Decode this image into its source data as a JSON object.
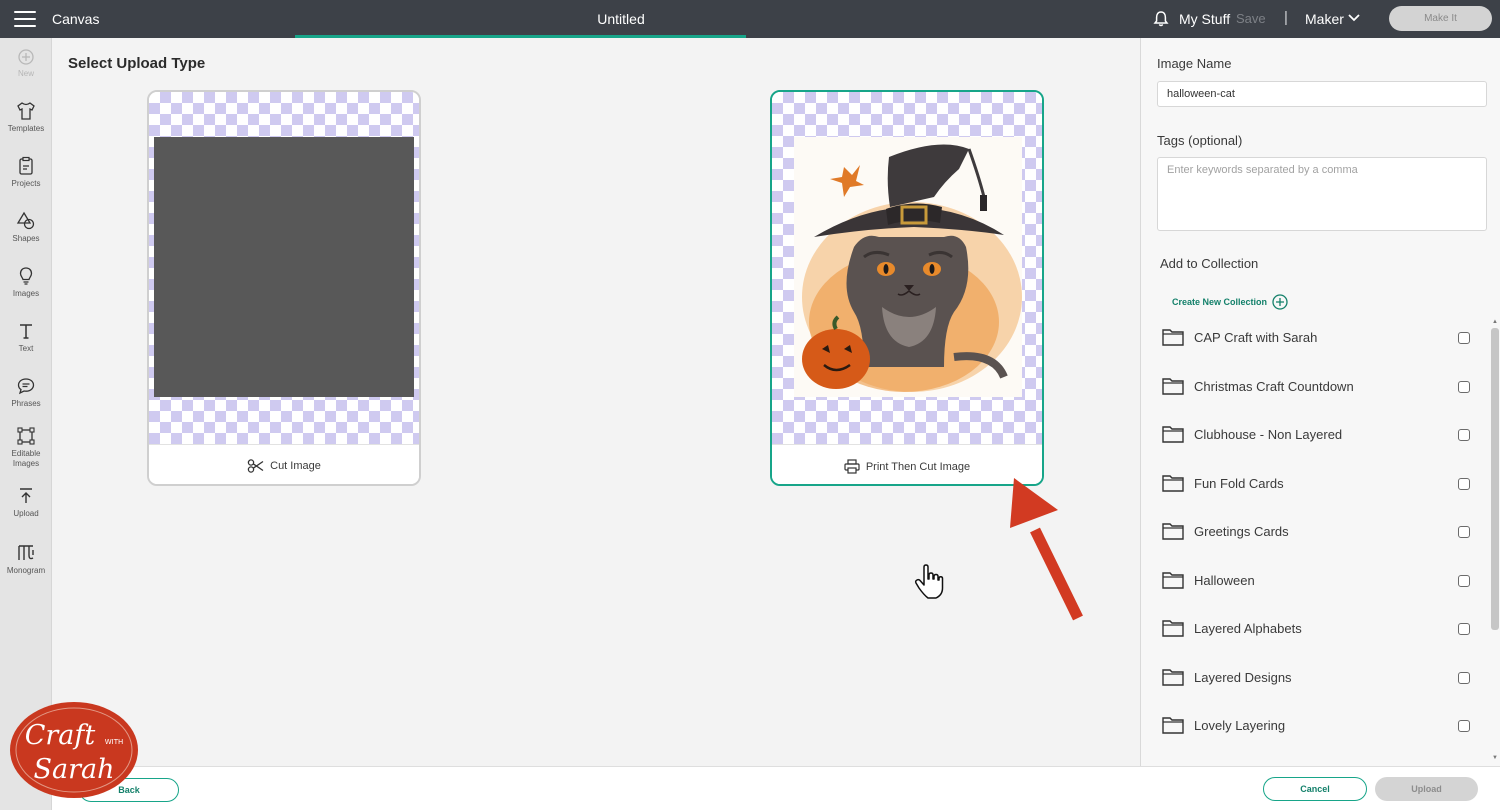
{
  "topbar": {
    "app_title": "Canvas",
    "doc_title": "Untitled",
    "my_stuff": "My Stuff",
    "save": "Save",
    "separator": "|",
    "machine": "Maker",
    "make_it": "Make It"
  },
  "sidebar": {
    "items": [
      {
        "label": "New",
        "icon": "plus-circle-icon"
      },
      {
        "label": "Templates",
        "icon": "tshirt-icon"
      },
      {
        "label": "Projects",
        "icon": "clipboard-icon"
      },
      {
        "label": "Shapes",
        "icon": "shapes-icon"
      },
      {
        "label": "Images",
        "icon": "lightbulb-icon"
      },
      {
        "label": "Text",
        "icon": "text-icon"
      },
      {
        "label": "Phrases",
        "icon": "speech-bubble-icon"
      },
      {
        "label": "Editable Images",
        "icon": "edit-image-icon"
      },
      {
        "label": "Upload",
        "icon": "upload-icon"
      },
      {
        "label": "Monogram",
        "icon": "monogram-icon"
      }
    ]
  },
  "main": {
    "title": "Select Upload Type",
    "options": [
      {
        "label": "Cut Image",
        "icon": "scissors-icon",
        "selected": false
      },
      {
        "label": "Print Then Cut Image",
        "icon": "printer-icon",
        "selected": true
      }
    ]
  },
  "panel": {
    "image_name_label": "Image Name",
    "image_name_value": "halloween-cat",
    "tags_label": "Tags (optional)",
    "tags_placeholder": "Enter keywords separated by a comma",
    "collection_label": "Add to Collection",
    "create_collection": "Create New Collection",
    "collections": [
      "CAP Craft with Sarah",
      "Christmas Craft Countdown",
      "Clubhouse - Non Layered",
      "Fun Fold Cards",
      "Greetings Cards",
      "Halloween",
      "Layered Alphabets",
      "Layered Designs",
      "Lovely Layering"
    ]
  },
  "bottom": {
    "back": "Back",
    "cancel": "Cancel",
    "upload": "Upload"
  },
  "watermark": {
    "line1": "Craft",
    "line2": "WITH",
    "line3": "Sarah"
  },
  "colors": {
    "accent": "#17a589",
    "topbar_bg": "#3d4148",
    "arrow": "#d23a22",
    "logo_bg": "#c9381f"
  }
}
